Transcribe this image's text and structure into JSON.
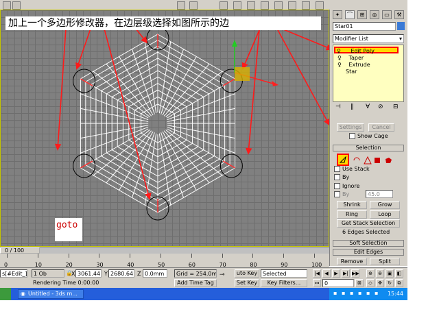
{
  "caption": "加上一个多边形修改器，在边层级选择如图所示的边",
  "annotation_goto": "goto",
  "command_panel": {
    "object_name": "Star01",
    "modifier_list": "Modifier List",
    "stack": [
      "Edit Poly",
      "Taper",
      "Extrude",
      "Star"
    ],
    "settings_button": "Settings",
    "cancel_button": "Cancel",
    "show_cage": "Show Cage",
    "selection_rollout": "Selection",
    "use_stack": "Use Stack",
    "by_vertex": "By",
    "ignore": "Ignore",
    "by_angle": "By",
    "angle_value": "45.0",
    "shrink": "Shrink",
    "grow": "Grow",
    "ring": "Ring",
    "loop": "Loop",
    "get_stack_selection": "Get Stack Selection",
    "selection_status": "6 Edges Selected",
    "soft_selection_rollout": "Soft Selection",
    "edit_edges_rollout": "Edit Edges",
    "remove": "Remove",
    "split": "Split"
  },
  "timeline": {
    "frame_readout": "0 / 100",
    "ticks": [
      "0",
      "10",
      "20",
      "30",
      "40",
      "50",
      "60",
      "70",
      "80",
      "90",
      "100"
    ]
  },
  "status": {
    "script_listener": "s[#Edit_]",
    "selection_count": "1 Ob",
    "x_label": "X",
    "x_value": "3061.44",
    "y_label": "Y",
    "y_value": "2680.64",
    "z_label": "Z",
    "z_value": "0.0mm",
    "grid": "Grid = 254.0m",
    "auto_key": "uto Key",
    "selected": "Selected",
    "set_key": "Set Key",
    "key_filters": "Key Filters...",
    "rendering_time": "Rendering Time  0:00:00",
    "add_time_tag": "Add Time Tag",
    "frame_value": "0"
  },
  "taskbar": {
    "task_item": "Untitled - 3ds m...",
    "clock": "15:44"
  },
  "colors": {
    "annotation_red": "#ff1a1a",
    "viewport_bg": "#808080",
    "selection_yellow": "#ffd800",
    "panel_bg": "#d4d0c8"
  }
}
